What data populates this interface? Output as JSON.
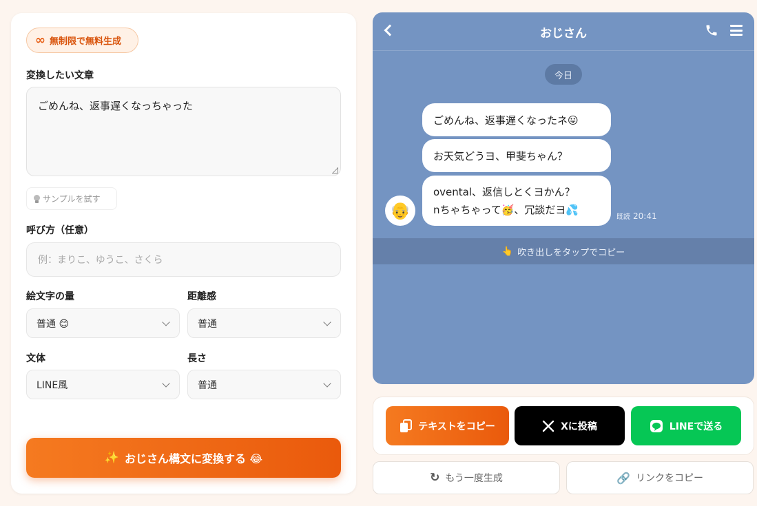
{
  "badge": {
    "icon": "infinity-icon",
    "label": "無制限で無料生成"
  },
  "form": {
    "text_label": "変換したい文章",
    "text_value": "ごめんね、返事遅くなっちゃった",
    "sample_label": "サンプルを試す",
    "name_label": "呼び方（任意）",
    "name_placeholder": "例：まりこ、ゆうこ、さくら",
    "emoji_label": "絵文字の量",
    "emoji_value": "普通 😊",
    "distance_label": "距離感",
    "distance_value": "普通",
    "style_label": "文体",
    "style_value": "LINE風",
    "length_label": "長さ",
    "length_value": "普通",
    "convert_label": "おじさん構文に変換する 😂"
  },
  "chat": {
    "title": "おじさん",
    "date": "今日",
    "bubbles": [
      "ごめんね、返事遅くなったネ😛",
      "お天気どうヨ、甲斐ちゃん？"
    ],
    "bubble3_line1": "ovental、返信しとくヨかん？",
    "bubble3_line2": "nちゃちゃって🥳、冗談だヨ💦",
    "avatar": "👴",
    "read_label": "既読",
    "time": "20:41",
    "tap_hint": "吹き出しをタップでコピー"
  },
  "actions": {
    "copy_label": "テキストをコピー",
    "x_label": "Xに投稿",
    "line_label": "LINEで送る",
    "regen_label": "もう一度生成",
    "link_label": "リンクをコピー"
  },
  "colors": {
    "accent": "#ea5a0c",
    "chat_bg": "#7494c2",
    "line_green": "#06c755"
  }
}
